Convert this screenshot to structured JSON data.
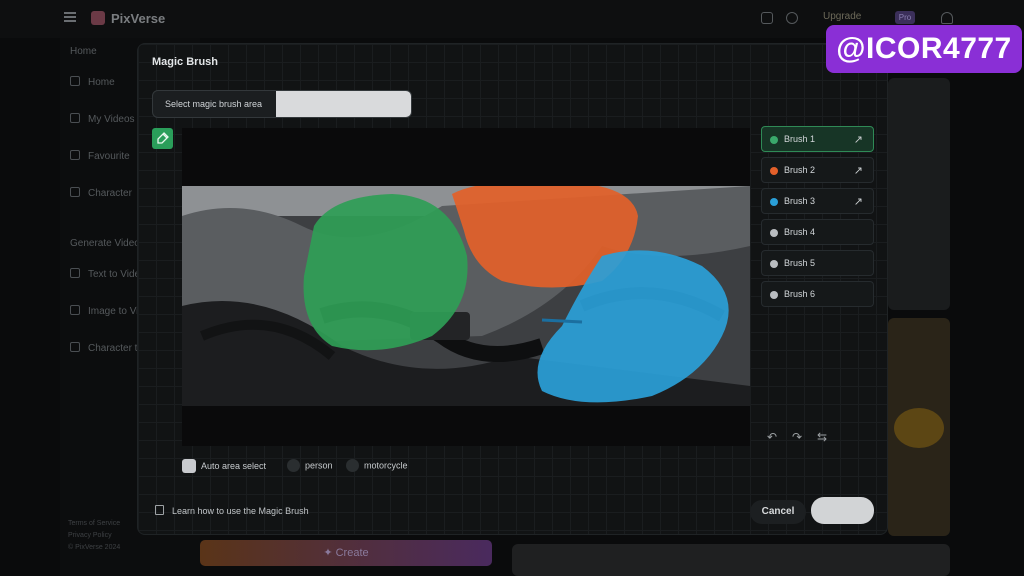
{
  "app": {
    "name": "PixVerse",
    "upgrade_label": "Upgrade",
    "pro_badge": "Pro"
  },
  "sidebar": {
    "section_home": "Home",
    "items": [
      {
        "label": "Home"
      },
      {
        "label": "My Videos"
      },
      {
        "label": "Favourite"
      },
      {
        "label": "Character"
      }
    ],
    "section_generate": "Generate Video",
    "generate_items": [
      {
        "label": "Text to Video"
      },
      {
        "label": "Image to Video"
      },
      {
        "label": "Character to Video"
      }
    ],
    "footer": [
      "Terms of Service",
      "Privacy Policy",
      "© PixVerse 2024"
    ],
    "create_label": "✦ Create"
  },
  "watermark": "@ICOR4777",
  "modal": {
    "title": "Magic Brush",
    "area_label": "Select magic brush area",
    "brushes": [
      {
        "label": "Brush 1",
        "color": "#3aa86b",
        "active": true,
        "has_arrow": true
      },
      {
        "label": "Brush 2",
        "color": "#e3602a",
        "active": false,
        "has_arrow": true
      },
      {
        "label": "Brush 3",
        "color": "#2a9fd8",
        "active": false,
        "has_arrow": true
      },
      {
        "label": "Brush 4",
        "color": "#b9bdc0",
        "active": false,
        "has_arrow": false
      },
      {
        "label": "Brush 5",
        "color": "#b9bdc0",
        "active": false,
        "has_arrow": false
      },
      {
        "label": "Brush 6",
        "color": "#b9bdc0",
        "active": false,
        "has_arrow": false
      }
    ],
    "arrow_glyph": "↗",
    "undo_glyph": "↶",
    "redo_glyph": "↷",
    "reset_glyph": "⇆",
    "auto_select_label": "Auto area select",
    "object_options": [
      "person",
      "motorcycle"
    ],
    "learn_label": "Learn how to use the Magic Brush",
    "cancel_label": "Cancel",
    "confirm_label": ""
  }
}
